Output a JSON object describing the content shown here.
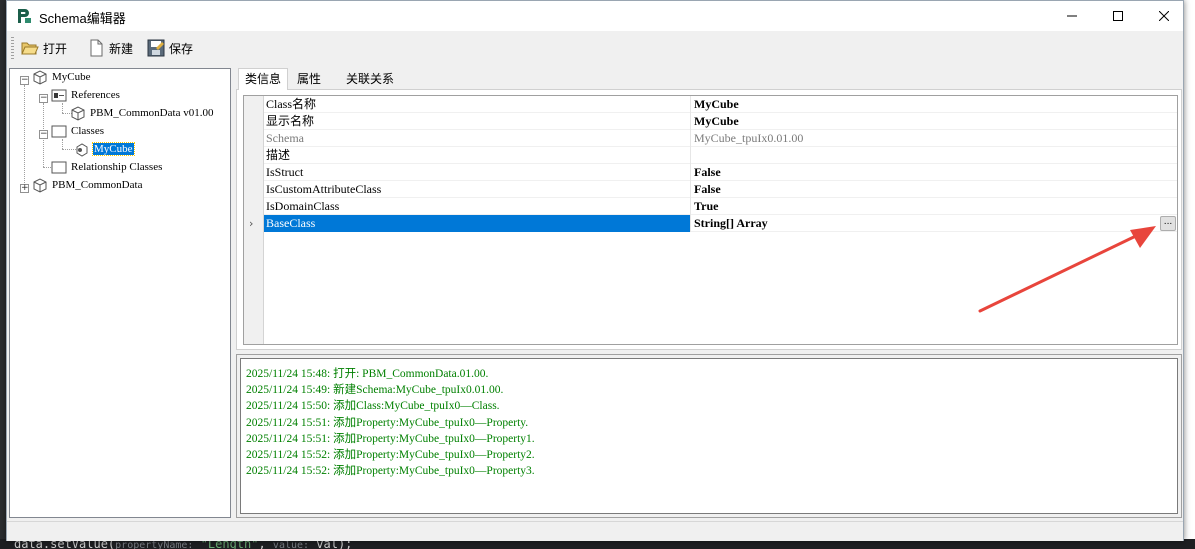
{
  "window": {
    "title": "Schema编辑器"
  },
  "toolbar": {
    "open_label": "打开",
    "new_label": "新建",
    "save_label": "保存"
  },
  "tree": {
    "root": "MyCube",
    "references": "References",
    "reference_item": "PBM_CommonData v01.00",
    "classes": "Classes",
    "class_item": "MyCube",
    "relationship_classes": "Relationship Classes",
    "second_root": "PBM_CommonData"
  },
  "tabs": [
    {
      "label": "类信息"
    },
    {
      "label": "属性"
    },
    {
      "label": "关联关系"
    }
  ],
  "properties": [
    {
      "name": "Class名称",
      "value": "MyCube"
    },
    {
      "name": "显示名称",
      "value": "MyCube"
    },
    {
      "name": "Schema",
      "value": "MyCube_tpuIx0.01.00"
    },
    {
      "name": "描述",
      "value": ""
    },
    {
      "name": "IsStruct",
      "value": "False"
    },
    {
      "name": "IsCustomAttributeClass",
      "value": "False"
    },
    {
      "name": "IsDomainClass",
      "value": "True"
    },
    {
      "name": "BaseClass",
      "value": "String[] Array"
    }
  ],
  "property_editor": {
    "ellipsis_label": "..."
  },
  "log": [
    "2025/11/24 15:48: 打开: PBM_CommonData.01.00.",
    "2025/11/24 15:49: 新建Schema:MyCube_tpuIx0.01.00.",
    "2025/11/24 15:50: 添加Class:MyCube_tpuIx0—Class.",
    "2025/11/24 15:51: 添加Property:MyCube_tpuIx0—Property.",
    "2025/11/24 15:51: 添加Property:MyCube_tpuIx0—Property1.",
    "2025/11/24 15:52: 添加Property:MyCube_tpuIx0—Property2.",
    "2025/11/24 15:52: 添加Property:MyCube_tpuIx0—Property3."
  ],
  "background_code": {
    "text": "data.setValue(",
    "param1": "propertyName:",
    "str": "\"Length\"",
    "param2": "value:",
    "tail": "val);"
  },
  "colors": {
    "selection": "#0078d7",
    "log_text": "#008000",
    "annotation_arrow": "#e8453c"
  }
}
